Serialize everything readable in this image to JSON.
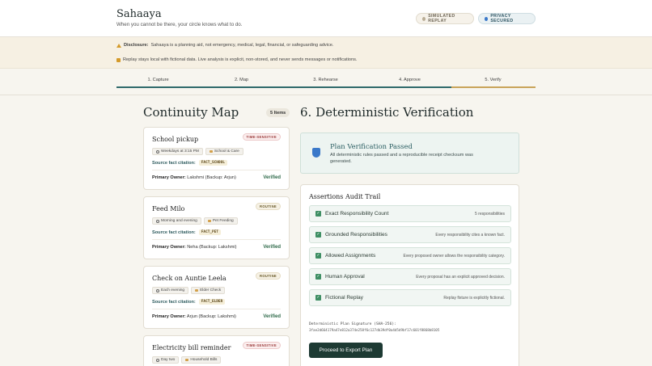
{
  "header": {
    "brand": "Sahaaya",
    "tagline": "When you cannot be there, your circle knows what to do.",
    "badges": {
      "replay": "SIMULATED REPLAY",
      "privacy": "PRIVACY SECURED"
    }
  },
  "notices": {
    "disclosure_label": "Disclosure:",
    "disclosure_text": "Sahaaya is a planning aid, not emergency, medical, legal, financial, or safeguarding advice.",
    "replay_text": "Replay stays local with fictional data. Live analysis is explicit, non-stored, and never sends messages or notifications."
  },
  "steps": [
    {
      "label": "1. Capture"
    },
    {
      "label": "2. Map"
    },
    {
      "label": "3. Rehearse"
    },
    {
      "label": "4. Approve"
    },
    {
      "label": "5. Verify"
    }
  ],
  "map": {
    "title": "Continuity Map",
    "count": "5 Items",
    "source_label": "Source fact citation:",
    "owner_label": "Primary Owner:",
    "cards": [
      {
        "title": "School pickup",
        "tag": "TIME-SENSITIVE",
        "when": "Weekdays at 3:15 PM",
        "category": "School & Care",
        "fact": "FACT_SCHOOL",
        "owner": "Lakshmi (Backup: Arjun)",
        "status": "Verified"
      },
      {
        "title": "Feed Milo",
        "tag": "ROUTINE",
        "when": "Morning and evening",
        "category": "Pet Feeding",
        "fact": "FACT_PET",
        "owner": "Neha (Backup: Lakshmi)",
        "status": "Verified"
      },
      {
        "title": "Check on Auntie Leela",
        "tag": "ROUTINE",
        "when": "Each evening",
        "category": "Elder Check",
        "fact": "FACT_ELDER",
        "owner": "Arjun (Backup: Lakshmi)",
        "status": "Verified"
      },
      {
        "title": "Electricity bill reminder",
        "tag": "TIME-SENSITIVE",
        "when": "Day two",
        "category": "Household Bills"
      }
    ]
  },
  "verification": {
    "title": "6. Deterministic Verification",
    "pass_title": "Plan Verification Passed",
    "pass_text": "All deterministic rules passed and a reproducible receipt checksum was generated.",
    "audit_title": "Assertions Audit Trail",
    "assertions": [
      {
        "name": "Exact Responsibility Count",
        "detail": "5 responsibilities"
      },
      {
        "name": "Grounded Responsibilities",
        "detail": "Every responsibility cites a known fact."
      },
      {
        "name": "Allowed Assignments",
        "detail": "Every proposed owner allows the responsibility category."
      },
      {
        "name": "Human Approval",
        "detail": "Every proposal has an explicit approved decision."
      },
      {
        "name": "Fictional Replay",
        "detail": "Replay fixture is explicitly fictional."
      }
    ],
    "signature_label": "Deterministic Plan Signature (SHA-256):",
    "signature_value": "3fae2d664179a47e812a374e258f6c127db39df0a4d5d9bf17c601f8868b8105",
    "export_label": "Proceed to Export Plan"
  },
  "colors": {
    "accent": "#2f6a6b",
    "active_step": "#c9a45a",
    "button": "#1d3a33",
    "pass": "#3f8f64"
  }
}
